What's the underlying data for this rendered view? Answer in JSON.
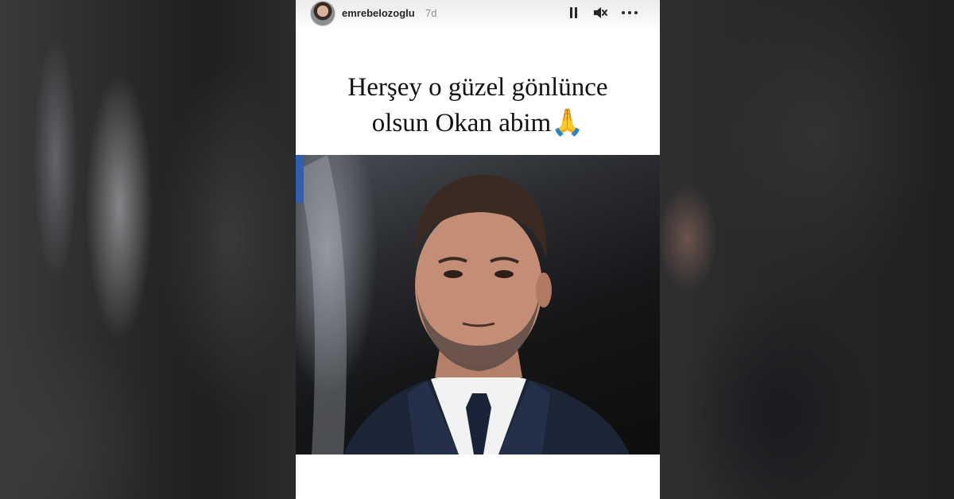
{
  "story": {
    "username": "emrebelozoglu",
    "time_ago": "7d",
    "caption_lines": [
      "Herşey o güzel gönlünce",
      "olsun Okan abim🙏"
    ],
    "photo_subject": "man in suit and tie portrait"
  },
  "controls": {
    "pause_icon": "pause-icon",
    "mute_icon": "mute-icon",
    "more_icon": "more-icon"
  },
  "colors": {
    "background": "#141414",
    "panel": "#ffffff",
    "text": "#111111",
    "muted": "#8e8e8e"
  }
}
